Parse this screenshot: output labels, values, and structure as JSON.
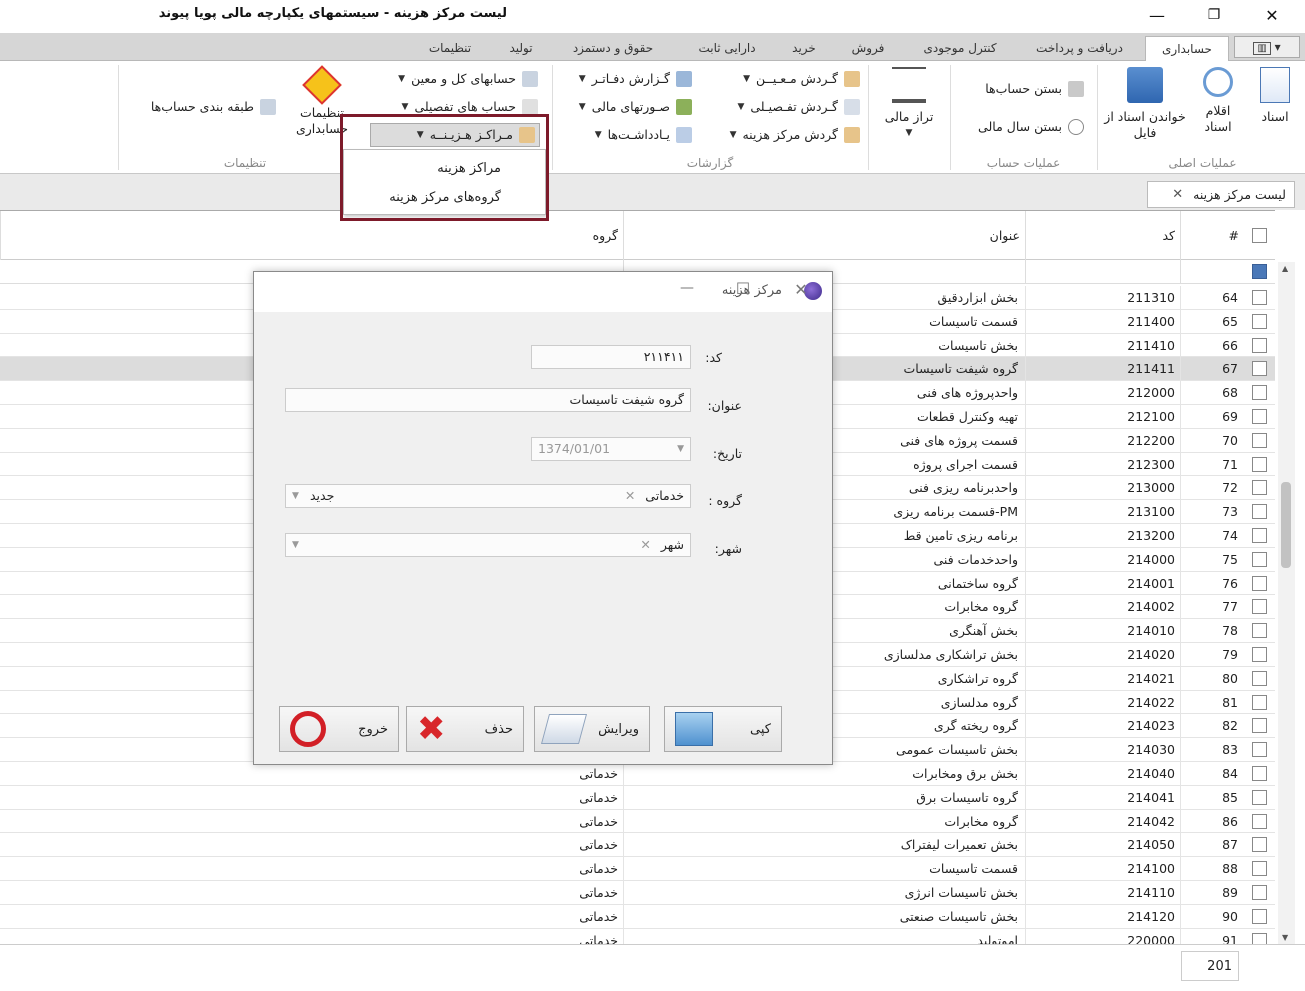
{
  "window": {
    "title": "لیست مرکز هزینه - سیستمهای یکپارچه مالی پویا پیوند",
    "minimize": "—",
    "maximize": "❐",
    "close": "✕"
  },
  "tabs": [
    "حسابداری",
    "دریافت و پرداخت",
    "کنترل موجودی",
    "فروش",
    "خرید",
    "دارایی ثابت",
    "حقوق و دستمزد",
    "تولید",
    "تنظیمات"
  ],
  "ribbon": {
    "main_ops": {
      "label": "عملیات اصلی",
      "docs": "اسناد",
      "doc_items": "اقلام اسناد",
      "read_docs": "خواندن اسناد از فایل"
    },
    "account_ops": {
      "label": "عملیات حساب",
      "close_accounts": "بستن حساب‌ها",
      "close_year": "بستن سال مالی"
    },
    "trial_balance": "تراز مالی",
    "reports": {
      "label": "گزارشات",
      "book_report": "گـزارش دفـاتـر",
      "statements": "صـورتهای مالی",
      "notes": "یـادداشـت‌ها",
      "sub_turnover": "گـردش مـعـیــن",
      "detail_turnover": "گـردش تفـصیـلی",
      "cc_turnover": "گردش مرکز هزینه"
    },
    "settings": {
      "label": "تنظیمات",
      "gl_accounts": "حسابهای کل و معین",
      "detail_accounts": "حساب های تفصیلی",
      "cost_centers": "مـراکـز هـزیـنــه",
      "acct_settings": "تنظیمات حسابداری",
      "acct_classification": "طبقه بندی حساب‌ها"
    }
  },
  "dropdown": {
    "items": [
      "مراکز هزینه",
      "گروه‌های مرکز هزینه"
    ]
  },
  "doc_tab": {
    "label": "لیست مرکز هزینه",
    "close": "✕"
  },
  "grid": {
    "headers": {
      "num": "#",
      "code": "کد",
      "title": "عنوان",
      "group": "گروه"
    },
    "rows": [
      {
        "n": "64",
        "code": "211310",
        "title": "بخش ابزاردقیق",
        "group": ""
      },
      {
        "n": "65",
        "code": "211400",
        "title": "قسمت تاسیسات",
        "group": ""
      },
      {
        "n": "66",
        "code": "211410",
        "title": "بخش تاسیسات",
        "group": ""
      },
      {
        "n": "67",
        "code": "211411",
        "title": "گروه شیفت تاسیسات",
        "group": ""
      },
      {
        "n": "68",
        "code": "212000",
        "title": "واحدپروژه های فنی",
        "group": ""
      },
      {
        "n": "69",
        "code": "212100",
        "title": "تهیه وکنترل قطعات",
        "group": ""
      },
      {
        "n": "70",
        "code": "212200",
        "title": "قسمت پروژه های فنی",
        "group": ""
      },
      {
        "n": "71",
        "code": "212300",
        "title": "قسمت اجرای پروژه",
        "group": ""
      },
      {
        "n": "72",
        "code": "213000",
        "title": "واحدبرنامه ریزی فنی",
        "group": ""
      },
      {
        "n": "73",
        "code": "213100",
        "title": "PM-قسمت برنامه ریزی",
        "group": ""
      },
      {
        "n": "74",
        "code": "213200",
        "title": "برنامه ریزی تامین قط",
        "group": ""
      },
      {
        "n": "75",
        "code": "214000",
        "title": "واحدخدمات فنی",
        "group": ""
      },
      {
        "n": "76",
        "code": "214001",
        "title": "گروه ساختمانی",
        "group": ""
      },
      {
        "n": "77",
        "code": "214002",
        "title": "گروه مخابرات",
        "group": ""
      },
      {
        "n": "78",
        "code": "214010",
        "title": "بخش آهنگری",
        "group": ""
      },
      {
        "n": "79",
        "code": "214020",
        "title": "بخش تراشکاری مدلسازی",
        "group": ""
      },
      {
        "n": "80",
        "code": "214021",
        "title": "گروه تراشکاری",
        "group": ""
      },
      {
        "n": "81",
        "code": "214022",
        "title": "گروه مدلسازی",
        "group": ""
      },
      {
        "n": "82",
        "code": "214023",
        "title": "گروه ریخته گری",
        "group": ""
      },
      {
        "n": "83",
        "code": "214030",
        "title": "بخش تاسیسات عمومی",
        "group": ""
      },
      {
        "n": "84",
        "code": "214040",
        "title": "بخش برق ومخابرات",
        "group": "خدماتی"
      },
      {
        "n": "85",
        "code": "214041",
        "title": "گروه تاسیسات برق",
        "group": "خدماتی"
      },
      {
        "n": "86",
        "code": "214042",
        "title": "گروه مخابرات",
        "group": "خدماتی"
      },
      {
        "n": "87",
        "code": "214050",
        "title": "بخش تعمیرات لیفتراک",
        "group": "خدماتی"
      },
      {
        "n": "88",
        "code": "214100",
        "title": "قسمت تاسیسات",
        "group": "خدماتی"
      },
      {
        "n": "89",
        "code": "214110",
        "title": "بخش تاسیسات انرژی",
        "group": "خدماتی"
      },
      {
        "n": "90",
        "code": "214120",
        "title": "بخش تاسیسات صنعتی",
        "group": "خدماتی"
      },
      {
        "n": "91",
        "code": "220000",
        "title": "اموتولید",
        "group": "خدماتی"
      }
    ],
    "total_count": "201"
  },
  "dialog": {
    "title": "مرکز هزینه",
    "minimize": "—",
    "maximize": "☐",
    "close": "✕",
    "code_label": "کد:",
    "code_value": "۲۱۱۴۱۱",
    "title_label": "عنوان:",
    "title_value": "گروه شیفت تاسیسات",
    "date_label": "تاریخ:",
    "date_value": "1374/01/01",
    "group_label": "گروه :",
    "group_value": "خدماتی",
    "group_new": "جدید",
    "city_label": "شهر:",
    "city_value": "شهر",
    "copy": "کپی",
    "edit": "ویرایش",
    "delete": "حذف",
    "exit": "خروج"
  }
}
